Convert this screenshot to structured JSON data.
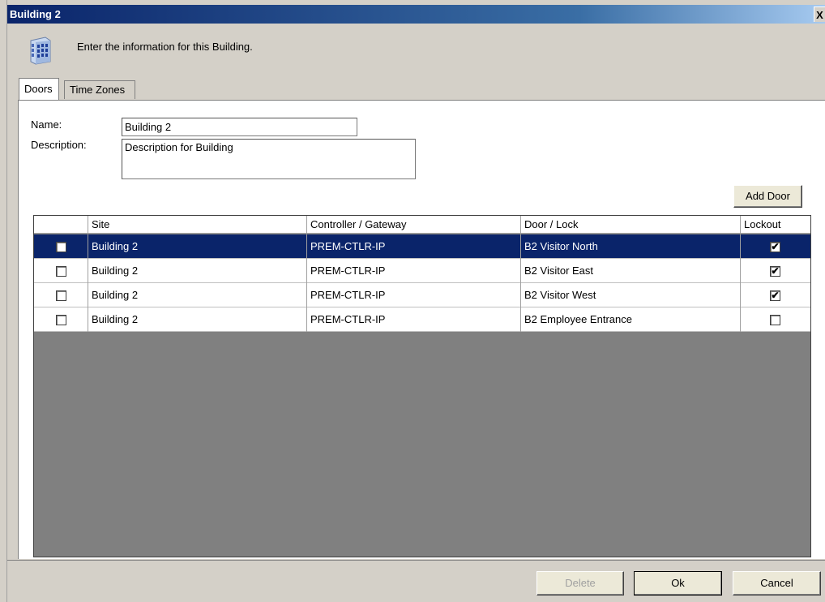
{
  "window": {
    "title": "Building 2",
    "close_glyph": "X"
  },
  "header": {
    "icon": "building-icon",
    "text": "Enter the information for this Building."
  },
  "tabs": [
    {
      "label": "Doors",
      "active": true
    },
    {
      "label": "Time Zones",
      "active": false
    }
  ],
  "form": {
    "name_label": "Name:",
    "name_value": "Building 2",
    "description_label": "Description:",
    "description_value": "Description for Building"
  },
  "add_door_label": "Add Door",
  "grid": {
    "columns": [
      "",
      "Site",
      "Controller / Gateway",
      "Door / Lock",
      "Lockout"
    ],
    "rows": [
      {
        "selected": false,
        "site": "Building 2",
        "controller": "PREM-CTLR-IP",
        "door": "B2 Visitor North",
        "lockout": true,
        "highlighted": true
      },
      {
        "selected": false,
        "site": "Building 2",
        "controller": "PREM-CTLR-IP",
        "door": "B2 Visitor East",
        "lockout": true,
        "highlighted": false
      },
      {
        "selected": false,
        "site": "Building 2",
        "controller": "PREM-CTLR-IP",
        "door": "B2 Visitor West",
        "lockout": true,
        "highlighted": false
      },
      {
        "selected": false,
        "site": "Building 2",
        "controller": "PREM-CTLR-IP",
        "door": "B2 Employee Entrance",
        "lockout": false,
        "highlighted": false
      }
    ]
  },
  "buttons": {
    "delete": "Delete",
    "ok": "Ok",
    "cancel": "Cancel"
  },
  "colors": {
    "selection": "#0a246a",
    "titlebar": "#0a246a",
    "grid_empty": "#808080",
    "window_bg": "#d4d0c8"
  }
}
